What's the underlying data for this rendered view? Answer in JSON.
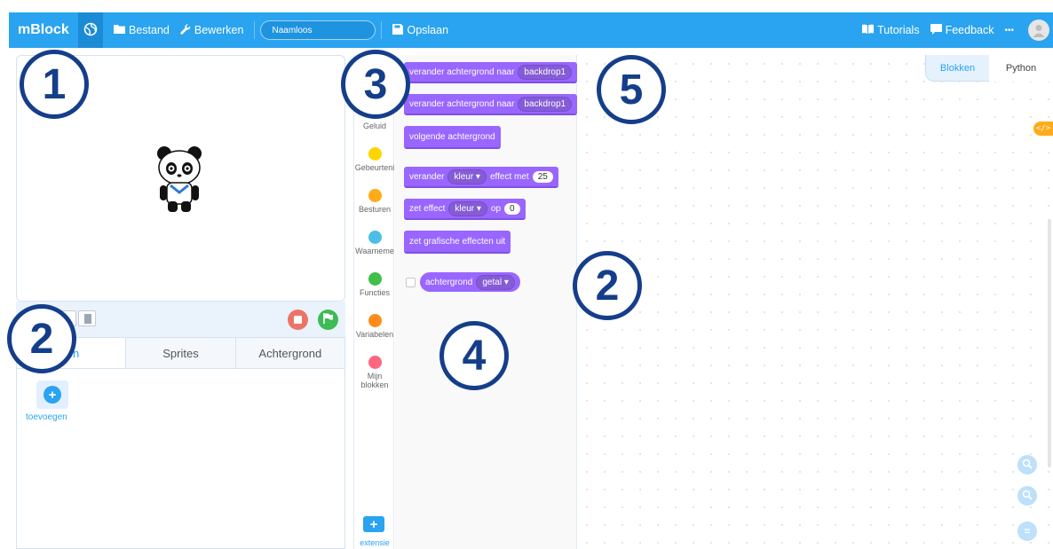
{
  "topbar": {
    "brand": "mBlock",
    "menu": {
      "file": "Bestand",
      "edit": "Bewerken",
      "save": "Opslaan"
    },
    "project_name": "Naamloos",
    "right": {
      "tutorials": "Tutorials",
      "feedback": "Feedback",
      "more": "•••"
    },
    "accent": "#2aa3f0"
  },
  "device_panel": {
    "tabs": [
      "ten",
      "Sprites",
      "Achtergrond"
    ],
    "add_label": "toevoegen"
  },
  "categories": [
    {
      "label": "Geluid",
      "color": ""
    },
    {
      "label": "Gebeurteni",
      "color": "#ffd500"
    },
    {
      "label": "Besturen",
      "color": "#ffab19"
    },
    {
      "label": "Waarneme",
      "color": "#4cbfe6"
    },
    {
      "label": "Functies",
      "color": "#40bf4a"
    },
    {
      "label": "Variabelen",
      "color": "#ff8c1a"
    },
    {
      "label": "Mijn blokken",
      "color": "#ff6680"
    }
  ],
  "extension_label": "extensie",
  "blocks": {
    "switch_backdrop_1": {
      "text": "verander achtergrond naar",
      "value": "backdrop1"
    },
    "switch_backdrop_2": {
      "text": "verander achtergrond naar",
      "value": "backdrop1"
    },
    "next_backdrop": {
      "text": "volgende achtergrond"
    },
    "change_effect": {
      "text_a": "verander",
      "dropdown": "kleur ▾",
      "text_b": "effect met",
      "value": "25"
    },
    "set_effect": {
      "text_a": "zet effect",
      "dropdown": "kleur ▾",
      "text_b": "op",
      "value": "0"
    },
    "clear_effects": {
      "text": "zet grafische effecten uit"
    },
    "backdrop_reporter": {
      "text": "achtergrond",
      "dropdown": "getal ▾"
    }
  },
  "script_area": {
    "tabs": [
      "Blokken",
      "Python"
    ],
    "active_tab": "Blokken",
    "code_badge": "</>"
  },
  "markers": [
    "1",
    "2",
    "3",
    "4",
    "5",
    "2"
  ],
  "colors": {
    "marker": "#153e8a",
    "looks_block": "#9966ff",
    "stop_button": "#ec7467",
    "go_button": "#3dbb56"
  }
}
